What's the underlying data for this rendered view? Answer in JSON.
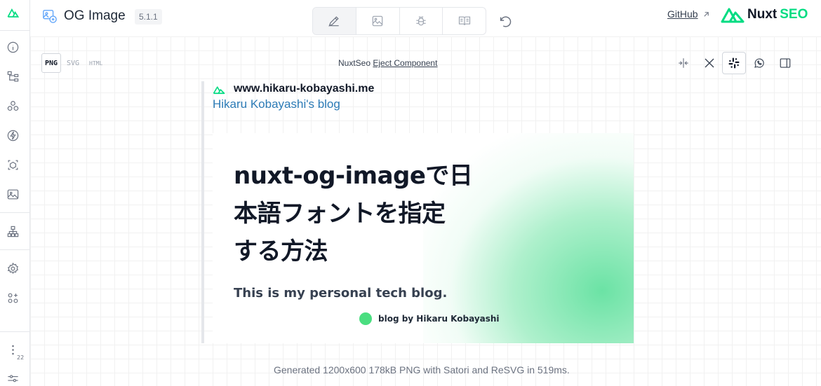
{
  "header": {
    "title": "OG Image",
    "version": "5.1.1",
    "github_label": "GitHub",
    "brand_name": "Nuxt",
    "brand_suffix": "SEO"
  },
  "sidebar": {
    "icons": [
      "nuxt-logo-icon",
      "info-icon",
      "hierarchy-icon",
      "components-icon",
      "bolt-icon",
      "cube-icon",
      "image-icon",
      "sitemap-icon",
      "settings-icon",
      "modules-icon"
    ],
    "badge_count": "22"
  },
  "toolbar": {
    "tabs": [
      "design-tab",
      "image-tab",
      "debug-tab",
      "docs-tab"
    ],
    "active_tab": 0
  },
  "formats": {
    "png": "PNG",
    "svg": "SVG",
    "html": "HTML"
  },
  "component": {
    "name": "NuxtSeo",
    "eject_label": "Eject Component"
  },
  "preview": {
    "site_url": "www.hikaru-kobayashi.me",
    "site_name": "Hikaru Kobayashi's blog",
    "og_title": "nuxt-og-imageで日本語フォントを指定する方法",
    "og_title_lines": [
      "nuxt-og-imageで日",
      "本語フォントを指定",
      "する方法"
    ],
    "og_description": "This is my personal tech blog.",
    "og_author": "blog by Hikaru Kobayashi",
    "accent_color": "#00dc82",
    "site_name_color": "#2c7bb6"
  },
  "footer": {
    "status": "Generated 1200x600 178kB PNG with Satori and ReSVG in 519ms."
  }
}
